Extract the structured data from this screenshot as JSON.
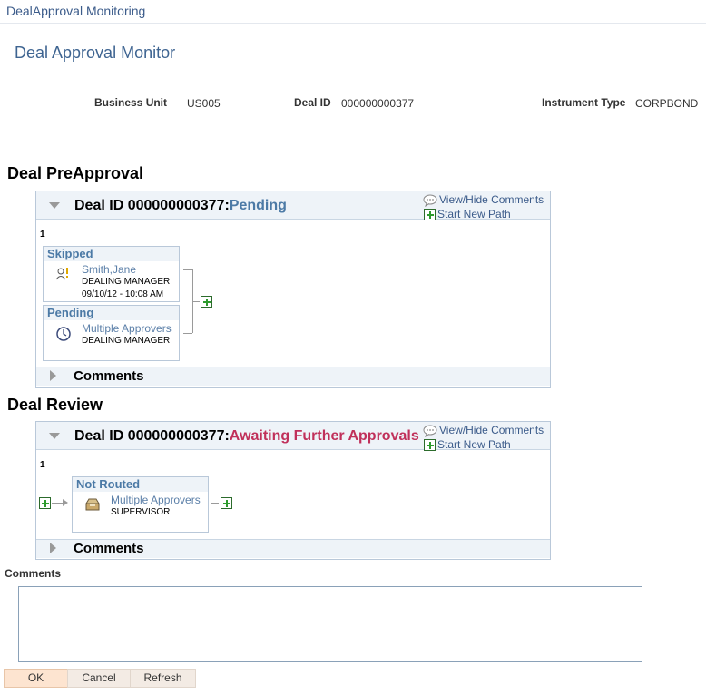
{
  "breadcrumb": "DealApproval Monitoring",
  "page_title": "Deal Approval Monitor",
  "fields": {
    "business_unit_label": "Business Unit",
    "business_unit_value": "US005",
    "deal_id_label": "Deal ID",
    "deal_id_value": "000000000377",
    "instrument_type_label": "Instrument Type",
    "instrument_type_value": "CORPBOND"
  },
  "preapproval": {
    "title": "Deal PreApproval",
    "header_prefix": "Deal ID 000000000377:",
    "status": "Pending",
    "view_hide": "View/Hide Comments",
    "start_path": "Start New Path",
    "stage_number": "1",
    "step1": {
      "status": "Skipped",
      "approver": "Smith,Jane",
      "role": "DEALING MANAGER",
      "timestamp": "09/10/12 - 10:08 AM",
      "icon": "user-warning-icon"
    },
    "step2": {
      "status": "Pending",
      "approver": "Multiple Approvers",
      "role": "DEALING MANAGER",
      "icon": "clock-icon"
    },
    "comments_label": "Comments"
  },
  "review": {
    "title": "Deal Review",
    "header_prefix": "Deal ID 000000000377:",
    "status": "Awaiting Further Approvals",
    "view_hide": "View/Hide Comments",
    "start_path": "Start New Path",
    "stage_number": "1",
    "step1": {
      "status": "Not Routed",
      "approver": "Multiple Approvers",
      "role": "SUPERVISOR",
      "icon": "inbox-icon"
    },
    "comments_label": "Comments"
  },
  "comments_label": "Comments",
  "comments_value": "",
  "buttons": {
    "ok": "OK",
    "cancel": "Cancel",
    "refresh": "Refresh"
  },
  "colors": {
    "link": "#3b5b8a",
    "pending": "#4c7aa6",
    "awaiting": "#c0305a"
  }
}
